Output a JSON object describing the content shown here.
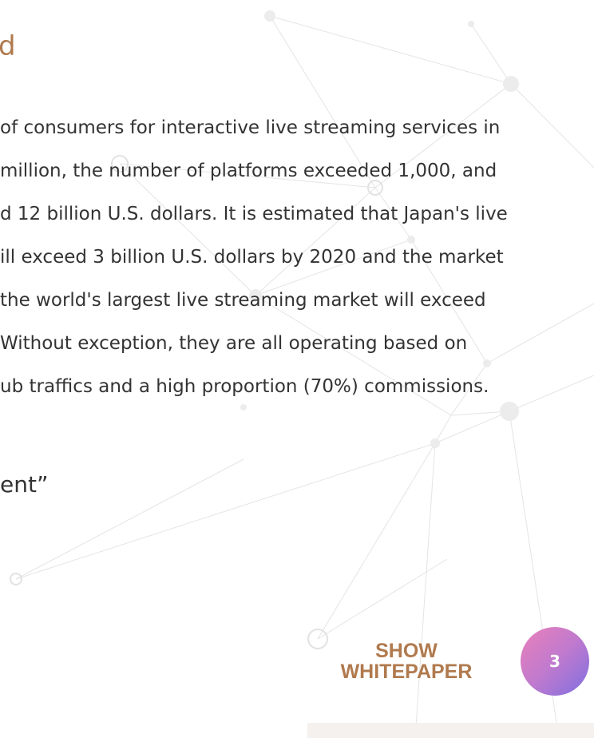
{
  "slide": {
    "heading": "d",
    "body_lines": [
      "of consumers for interactive live streaming services in",
      "million, the number of platforms exceeded 1,000, and",
      "d 12 billion U.S. dollars. It is estimated that Japan's live",
      "ill exceed 3 billion U.S. dollars by 2020 and the market",
      "the world's largest live streaming market will exceed",
      "Without exception, they are all operating based on",
      "ub traffics and a high proportion (70%) commissions."
    ],
    "quote_tail": "ent”"
  },
  "brand": {
    "line1": "SHOW",
    "line2": "WHITEPAPER"
  },
  "page_number": "3",
  "colors": {
    "accent": "#b07a4e",
    "text": "#333333",
    "badge_gradient": [
      "#ea80b9",
      "#c07ace",
      "#7e6fe0"
    ]
  }
}
